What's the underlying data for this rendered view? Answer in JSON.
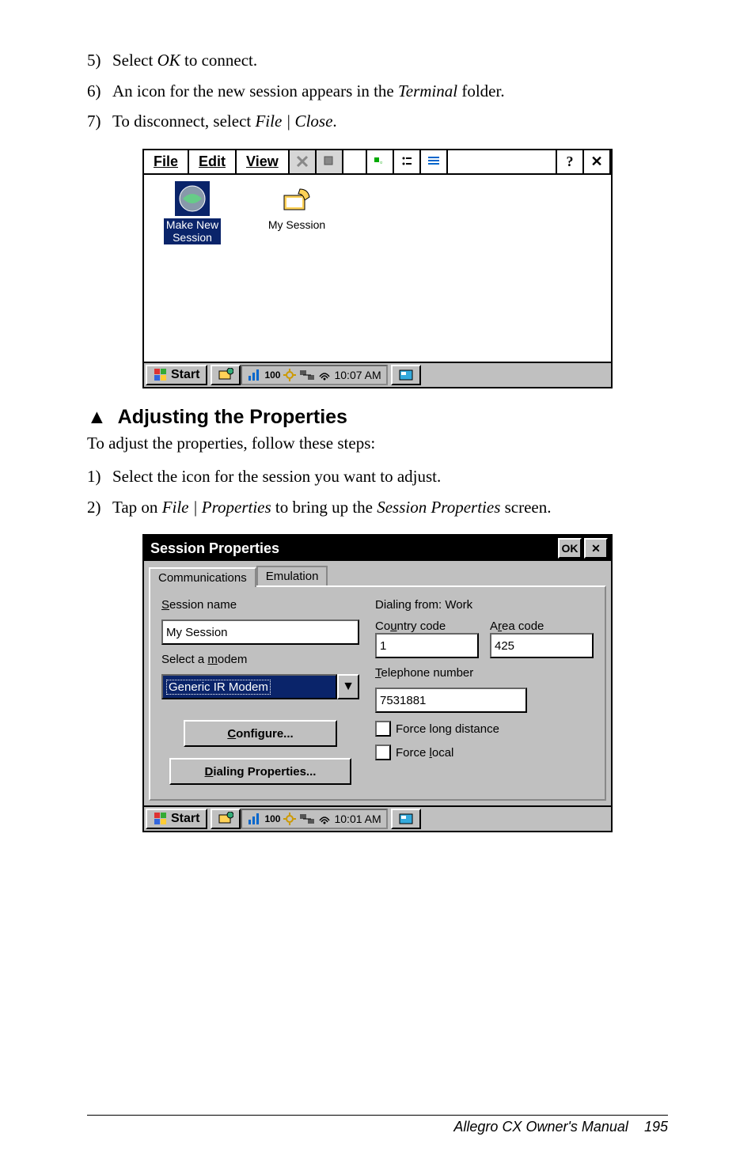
{
  "steps_a": [
    {
      "n": "5)",
      "pre": "Select ",
      "ital": "OK",
      "post": " to connect."
    },
    {
      "n": "6)",
      "pre": "An icon for the new session appears in the ",
      "ital": "Terminal",
      "post": " folder."
    },
    {
      "n": "7)",
      "pre": "To disconnect, select ",
      "ital": "File | Close",
      "post": "."
    }
  ],
  "terminal": {
    "menu": {
      "file": "File",
      "edit": "Edit",
      "view": "View"
    },
    "help": "?",
    "close": "✕",
    "icons": [
      {
        "label_1": "Make New",
        "label_2": "Session",
        "selected": true,
        "kind": "globe"
      },
      {
        "label_1": "My Session",
        "label_2": "",
        "selected": false,
        "kind": "phone"
      }
    ],
    "taskbar": {
      "start": "Start",
      "time": "10:07 AM",
      "battery": "100"
    }
  },
  "heading": "Adjusting the Properties",
  "intro": "To adjust the properties, follow these steps:",
  "steps_b": [
    {
      "n": "1)",
      "pre": "Select the icon for the session you want to adjust.",
      "ital": "",
      "post": ""
    },
    {
      "n": "2)",
      "pre": "Tap on ",
      "ital": "File | Properties",
      "post": " to bring up the ",
      "ital2": "Session Properties",
      "post2": " screen."
    }
  ],
  "session": {
    "title": "Session Properties",
    "ok": "OK",
    "close": "✕",
    "tabs": {
      "comm": "Communications",
      "emu": "Emulation"
    },
    "left": {
      "session_name_lbl": "Session name",
      "session_name_u": "S",
      "session_name_val": "My Session",
      "modem_lbl": "Select a modem",
      "modem_u": "m",
      "modem_val": "Generic IR Modem",
      "configure": "Configure...",
      "configure_u": "C",
      "dialprop": "Dialing Properties...",
      "dialprop_u": "D"
    },
    "right": {
      "dialing_from": "Dialing from: Work",
      "country_lbl": "Country code",
      "country_u": "u",
      "area_lbl": "Area code",
      "area_u": "r",
      "country_val": "1",
      "area_val": "425",
      "tel_lbl": "Telephone number",
      "tel_u": "T",
      "tel_val": "7531881",
      "long_lbl": "Force long distance",
      "long_u": "g",
      "local_lbl": "Force local",
      "local_u": "l"
    },
    "taskbar": {
      "start": "Start",
      "time": "10:01 AM",
      "battery": "100"
    }
  },
  "footer": {
    "text": "Allegro CX Owner's Manual",
    "page": "195"
  },
  "chart_data": null
}
